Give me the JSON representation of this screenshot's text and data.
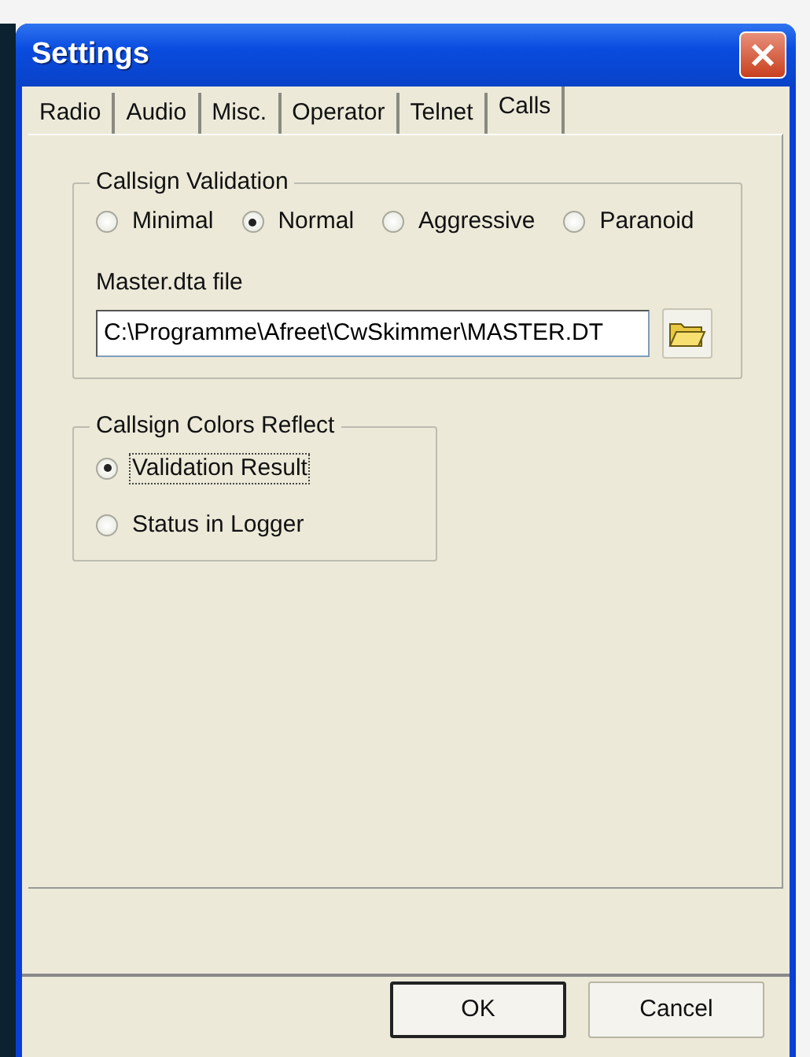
{
  "window": {
    "title": "Settings"
  },
  "tabs": [
    {
      "label": "Radio",
      "selected": false
    },
    {
      "label": "Audio",
      "selected": false
    },
    {
      "label": "Misc.",
      "selected": false
    },
    {
      "label": "Operator",
      "selected": false
    },
    {
      "label": "Telnet",
      "selected": false
    },
    {
      "label": "Calls",
      "selected": true
    }
  ],
  "validation_group": {
    "title": "Callsign Validation",
    "options": [
      {
        "label": "Minimal",
        "selected": false
      },
      {
        "label": "Normal",
        "selected": true
      },
      {
        "label": "Aggressive",
        "selected": false
      },
      {
        "label": "Paranoid",
        "selected": false
      }
    ],
    "file_label": "Master.dta file",
    "file_value": "C:\\Programme\\Afreet\\CwSkimmer\\MASTER.DT"
  },
  "colors_group": {
    "title": "Callsign Colors Reflect",
    "options": [
      {
        "label": "Validation Result",
        "selected": true,
        "focused": true
      },
      {
        "label": "Status in Logger",
        "selected": false,
        "focused": false
      }
    ]
  },
  "buttons": [
    {
      "label": "OK",
      "default": true
    },
    {
      "label": "Cancel",
      "default": false
    }
  ]
}
